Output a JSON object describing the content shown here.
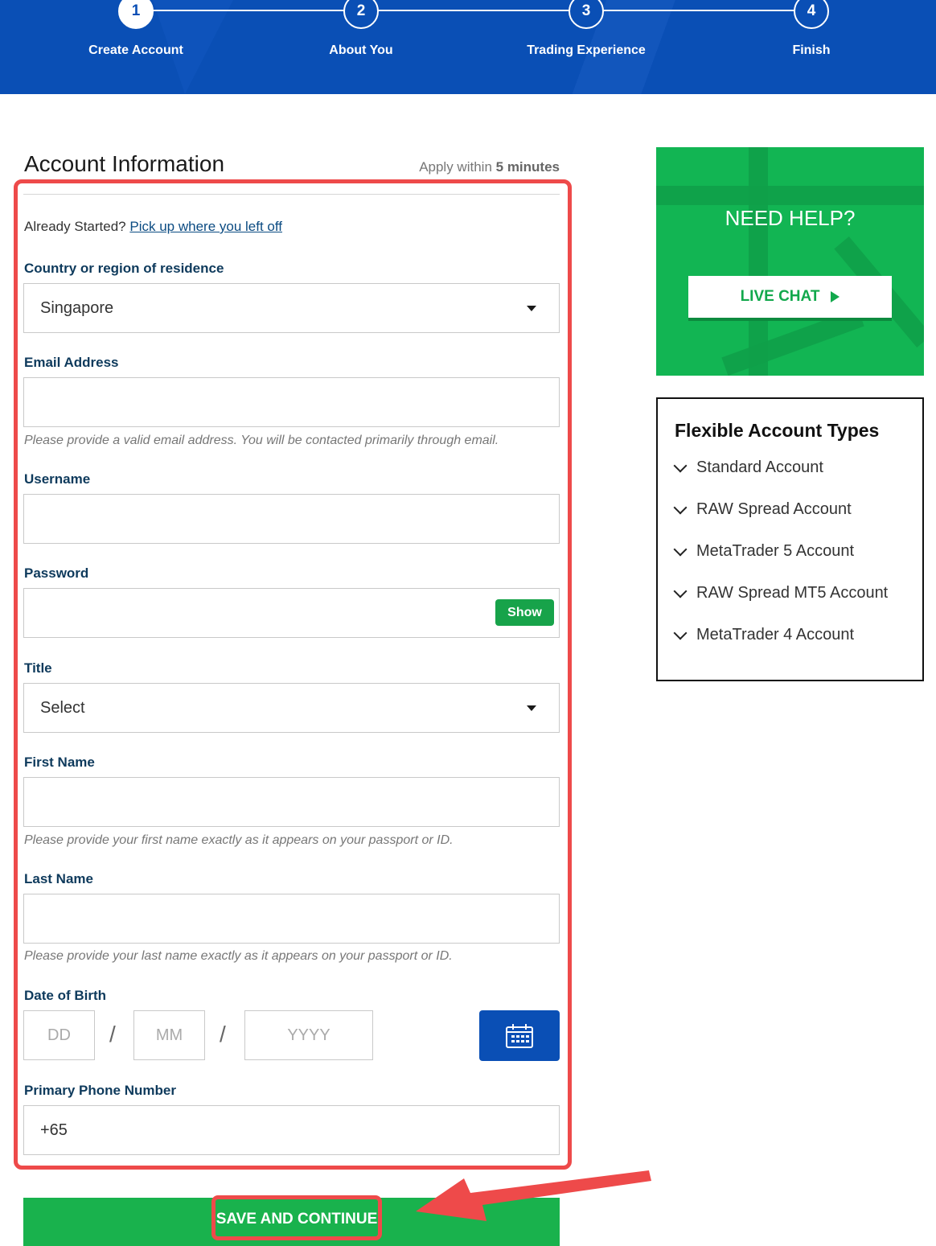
{
  "stepper": {
    "steps": [
      {
        "num": "1",
        "label": "Create Account"
      },
      {
        "num": "2",
        "label": "About You"
      },
      {
        "num": "3",
        "label": "Trading Experience"
      },
      {
        "num": "4",
        "label": "Finish"
      }
    ]
  },
  "form": {
    "title": "Account Information",
    "apply_prefix": "Apply within",
    "apply_time": "5 minutes",
    "already_started": "Already Started?",
    "pickup_link": "Pick up where you left off",
    "country": {
      "label": "Country or region of residence",
      "value": "Singapore"
    },
    "email": {
      "label": "Email Address",
      "value": "",
      "hint": "Please provide a valid email address. You will be contacted primarily through email."
    },
    "username": {
      "label": "Username",
      "value": ""
    },
    "password": {
      "label": "Password",
      "value": "",
      "show_label": "Show"
    },
    "title_field": {
      "label": "Title",
      "value": "Select"
    },
    "first_name": {
      "label": "First Name",
      "value": "",
      "hint": "Please provide your first name exactly as it appears on your passport or ID."
    },
    "last_name": {
      "label": "Last Name",
      "value": "",
      "hint": "Please provide your last name exactly as it appears on your passport or ID."
    },
    "dob": {
      "label": "Date of Birth",
      "dd": "DD",
      "mm": "MM",
      "yyyy": "YYYY",
      "separator": "/"
    },
    "phone": {
      "label": "Primary Phone Number",
      "value": "+65"
    },
    "save_label": "SAVE AND CONTINUE"
  },
  "help": {
    "title": "NEED HELP?",
    "chat_label": "LIVE CHAT"
  },
  "account_types": {
    "title": "Flexible Account Types",
    "items": [
      "Standard Account",
      "RAW Spread Account",
      "MetaTrader 5 Account",
      "RAW Spread MT5 Account",
      "MetaTrader 4 Account"
    ]
  },
  "colors": {
    "header_blue": "#0a4fb5",
    "accent_green": "#19b24d",
    "annotation_red": "#ee4a4a"
  }
}
